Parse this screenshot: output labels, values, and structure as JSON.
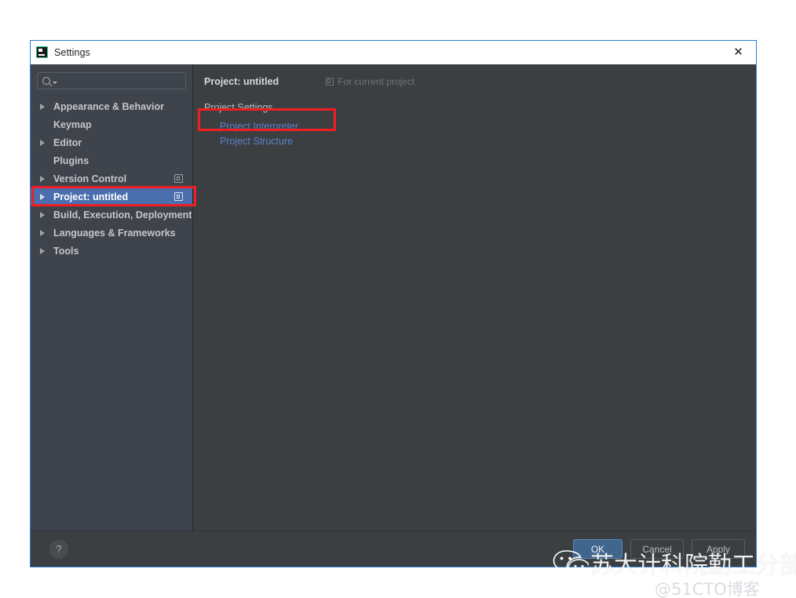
{
  "window": {
    "title": "Settings",
    "icon": "pycharm-icon",
    "close_label": "✕"
  },
  "sidebar": {
    "search": {
      "value": "",
      "placeholder": "",
      "icon": "search-icon",
      "dropdown_icon": "chevron-down-icon"
    },
    "items": [
      {
        "label": "Appearance & Behavior",
        "expandable": true,
        "selected": false,
        "module_icon": false
      },
      {
        "label": "Keymap",
        "expandable": false,
        "selected": false,
        "module_icon": false
      },
      {
        "label": "Editor",
        "expandable": true,
        "selected": false,
        "module_icon": false
      },
      {
        "label": "Plugins",
        "expandable": false,
        "selected": false,
        "module_icon": false
      },
      {
        "label": "Version Control",
        "expandable": true,
        "selected": false,
        "module_icon": true
      },
      {
        "label": "Project: untitled",
        "expandable": true,
        "selected": true,
        "module_icon": true
      },
      {
        "label": "Build, Execution, Deployment",
        "expandable": true,
        "selected": false,
        "module_icon": false
      },
      {
        "label": "Languages & Frameworks",
        "expandable": true,
        "selected": false,
        "module_icon": false
      },
      {
        "label": "Tools",
        "expandable": true,
        "selected": false,
        "module_icon": false
      }
    ]
  },
  "content": {
    "title": "Project: untitled",
    "scope_icon": "module-scope-icon",
    "scope_label": "For current project",
    "section_title": "Project Settings",
    "links": [
      {
        "label": "Project Interpreter"
      },
      {
        "label": "Project Structure"
      }
    ]
  },
  "footer": {
    "help_label": "?",
    "ok_label": "OK",
    "cancel_label": "Cancel",
    "apply_label": "Apply"
  },
  "watermark": {
    "logo": "wechat-icon",
    "text": "苏大计科院勤工分部",
    "subtext": "@51CTO博客"
  },
  "colors": {
    "accent_selection": "#4b6eaf",
    "link": "#5b82c9",
    "annotation_red": "#f01e23",
    "window_border": "#2a7fd4",
    "panel_bg": "#3c3f41",
    "sidebar_bg": "#3f434c",
    "primary_button": "#41668d"
  }
}
